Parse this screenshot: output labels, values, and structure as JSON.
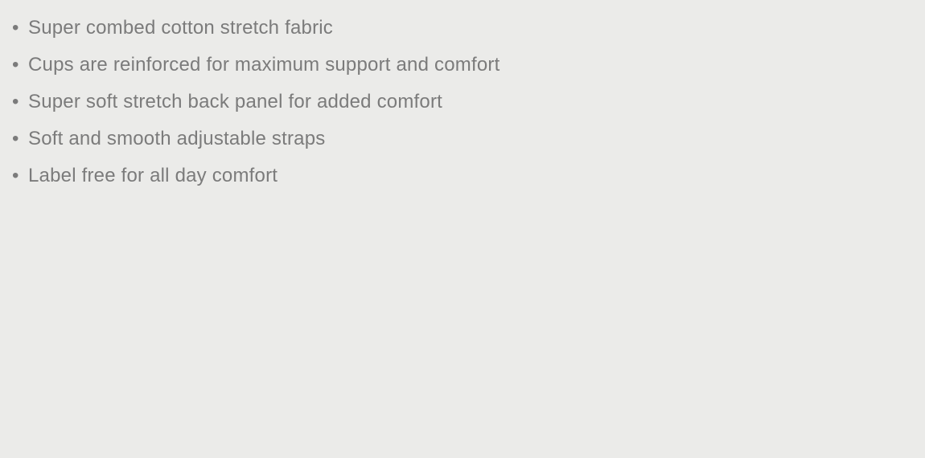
{
  "feature_list": {
    "bullet": "•",
    "items": [
      "Super combed cotton stretch fabric",
      "Cups are reinforced for maximum support and comfort",
      "Super soft stretch back panel for added comfort",
      "Soft and smooth adjustable straps",
      "Label free for all day comfort"
    ]
  },
  "colors": {
    "background": "#ebebe9",
    "text": "#7b7b7b"
  }
}
